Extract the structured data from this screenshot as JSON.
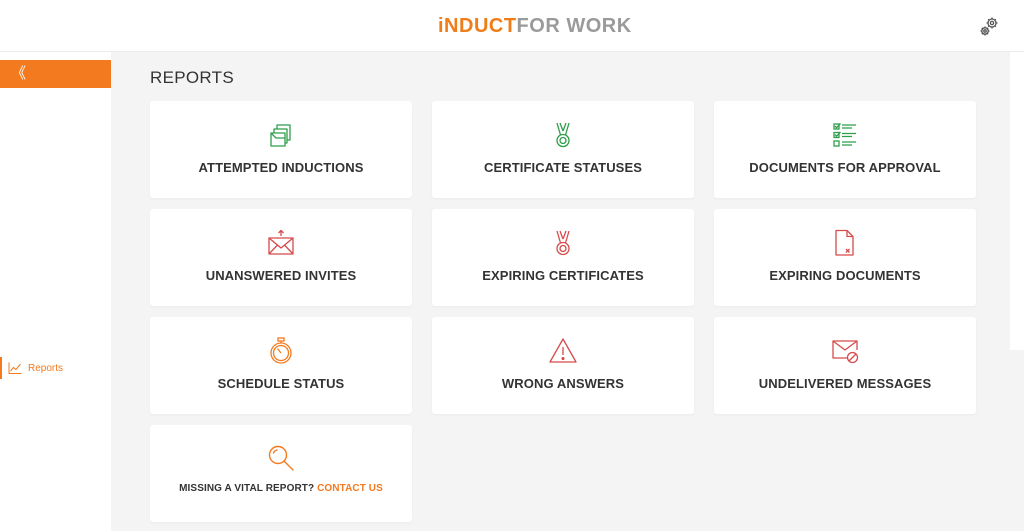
{
  "header": {
    "logo_part1": "iNDUCT",
    "logo_part2": "FOR WORK"
  },
  "sidebar": {
    "collapse_glyph": "《",
    "items": [
      {
        "label": "Reports",
        "icon": "line-chart-icon"
      }
    ]
  },
  "page": {
    "title": "REPORTS"
  },
  "cards": [
    {
      "label": "ATTEMPTED INDUCTIONS",
      "icon": "stacked-documents-icon",
      "color": "#2e9e4a"
    },
    {
      "label": "CERTIFICATE STATUSES",
      "icon": "medal-icon",
      "color": "#2e9e4a"
    },
    {
      "label": "DOCUMENTS FOR APPROVAL",
      "icon": "checklist-icon",
      "color": "#2e9e4a"
    },
    {
      "label": "UNANSWERED INVITES",
      "icon": "envelope-upload-icon",
      "color": "#d64b4b"
    },
    {
      "label": "EXPIRING CERTIFICATES",
      "icon": "medal-icon",
      "color": "#d64b4b"
    },
    {
      "label": "EXPIRING DOCUMENTS",
      "icon": "document-remove-icon",
      "color": "#d64b4b"
    },
    {
      "label": "SCHEDULE STATUS",
      "icon": "stopwatch-icon",
      "color": "#f47a1f"
    },
    {
      "label": "WRONG ANSWERS",
      "icon": "warning-icon",
      "color": "#d64b4b"
    },
    {
      "label": "UNDELIVERED MESSAGES",
      "icon": "envelope-blocked-icon",
      "color": "#d64b4b"
    }
  ],
  "missing_report": {
    "text": "MISSING A VITAL REPORT? ",
    "link": "CONTACT US",
    "icon": "magnifier-icon",
    "color": "#f47a1f"
  },
  "colors": {
    "accent": "#f47a1f",
    "green": "#2e9e4a",
    "red": "#d64b4b"
  }
}
